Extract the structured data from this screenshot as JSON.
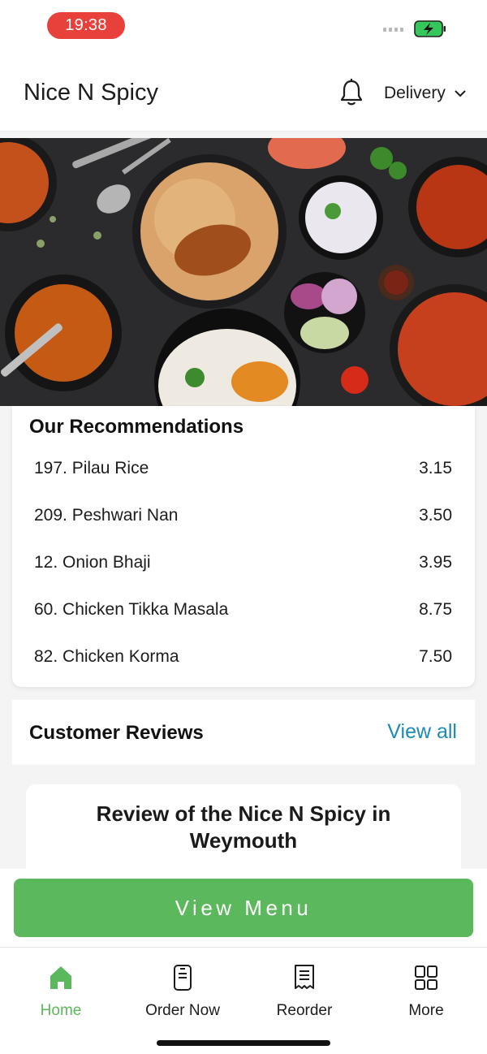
{
  "status_bar": {
    "time": "19:38",
    "time_pill_color": "#e8403b",
    "battery_color": "#34c759"
  },
  "header": {
    "title": "Nice N Spicy",
    "bell_icon": "bell-icon",
    "delivery_label": "Delivery",
    "chevron_icon": "chevron-down-icon"
  },
  "hero": {
    "description_icon": "food-spread-image"
  },
  "recommendations": {
    "title": "Our Recommendations",
    "items": [
      {
        "name": "197. Pilau Rice",
        "price": "3.15"
      },
      {
        "name": "209. Peshwari Nan",
        "price": "3.50"
      },
      {
        "name": "12. Onion Bhaji",
        "price": "3.95"
      },
      {
        "name": "60. Chicken Tikka Masala",
        "price": "8.75"
      },
      {
        "name": "82. Chicken Korma",
        "price": "7.50"
      }
    ]
  },
  "reviews": {
    "title": "Customer Reviews",
    "view_all": "View all",
    "review_title": "Review of the Nice N Spicy in Weymouth"
  },
  "actions": {
    "view_menu": "View Menu"
  },
  "tab_bar": {
    "tabs": [
      {
        "label": "Home",
        "icon": "home-icon",
        "active": true
      },
      {
        "label": "Order Now",
        "icon": "mobile-order-icon",
        "active": false
      },
      {
        "label": "Reorder",
        "icon": "receipt-icon",
        "active": false
      },
      {
        "label": "More",
        "icon": "grid-icon",
        "active": false
      }
    ]
  },
  "colors": {
    "accent_green": "#5cb85c",
    "link_blue": "#1b8ab8"
  }
}
